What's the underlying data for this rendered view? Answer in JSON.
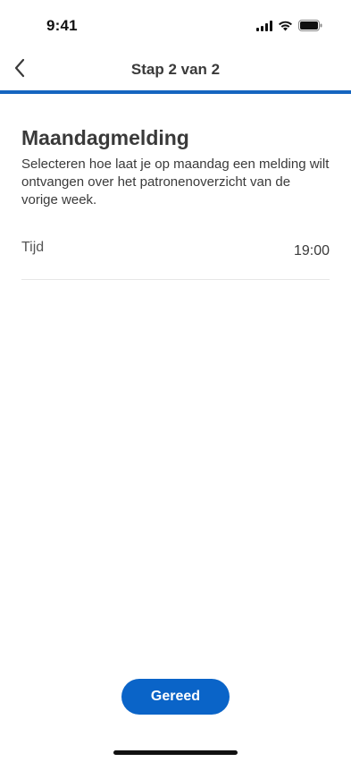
{
  "status_bar": {
    "time": "9:41",
    "icons": [
      "cellular-signal-icon",
      "wifi-icon",
      "battery-icon"
    ]
  },
  "nav": {
    "title": "Stap 2 van 2",
    "back_icon": "chevron-left-icon"
  },
  "progress": {
    "current_step": 2,
    "total_steps": 2,
    "fraction": 1.0,
    "color": "#1565c0"
  },
  "main": {
    "heading": "Maandagmelding",
    "description": "Selecteren hoe laat je op maandag een melding wilt ontvangen over het patronenoverzicht van de vorige week.",
    "time_row": {
      "label": "Tijd",
      "value": "19:00"
    }
  },
  "footer": {
    "done_label": "Gereed",
    "button_color": "#0a64c8"
  }
}
